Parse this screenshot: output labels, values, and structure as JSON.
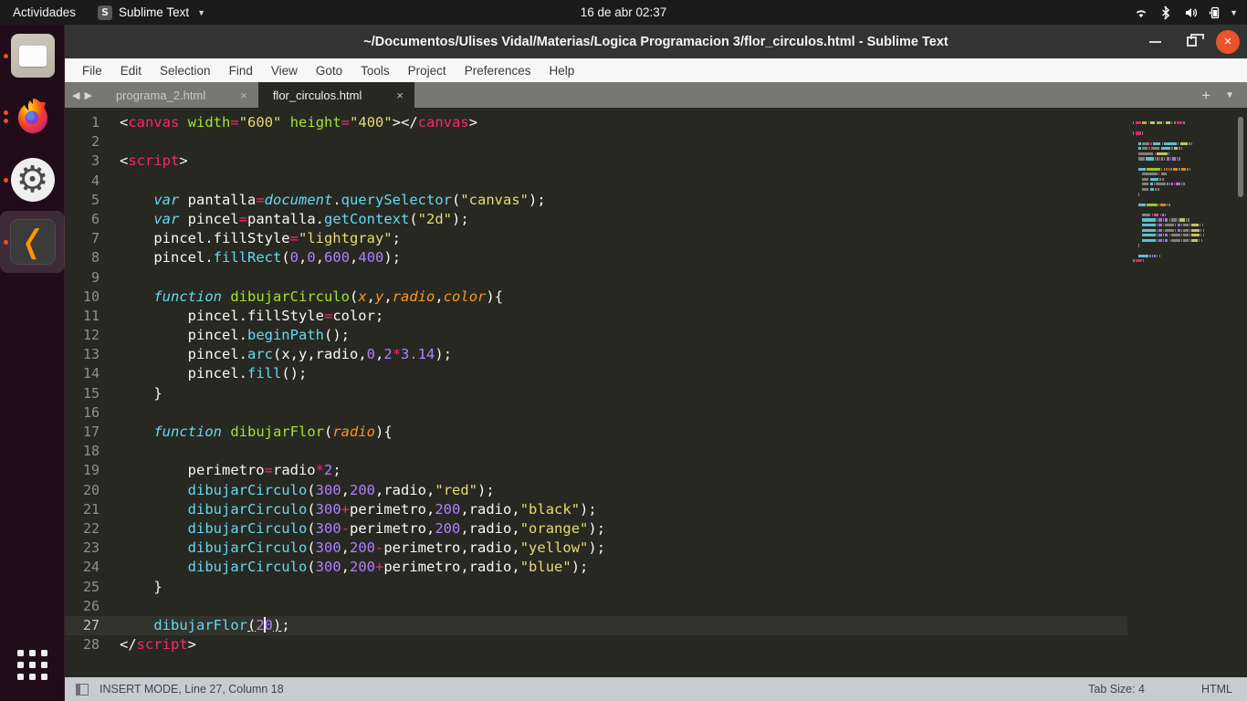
{
  "topbar": {
    "activities": "Actividades",
    "app_name": "Sublime Text",
    "app_icon": "sublime-icon",
    "app_icon_glyph": "S",
    "clock": "16 de abr  02:37",
    "tray_icons": [
      "wifi-icon",
      "bluetooth-icon",
      "volume-icon",
      "battery-icon",
      "chevron-down-icon"
    ]
  },
  "dock": {
    "items": [
      {
        "name": "files",
        "label": "Files",
        "running": true
      },
      {
        "name": "firefox",
        "label": "Firefox",
        "running": true
      },
      {
        "name": "settings",
        "label": "Settings",
        "running": true
      },
      {
        "name": "sublime-text",
        "label": "Sublime Text",
        "running": true,
        "active": true
      }
    ],
    "app_grid_label": "Show Applications"
  },
  "window": {
    "title": "~/Documentos/Ulises Vidal/Materias/Logica Programacion 3/flor_circulos.html - Sublime Text",
    "controls": {
      "minimize": "minimize-button",
      "maximize": "maximize-button",
      "close": "close-button",
      "close_glyph": "×"
    }
  },
  "menubar": {
    "items": [
      "File",
      "Edit",
      "Selection",
      "Find",
      "View",
      "Goto",
      "Tools",
      "Project",
      "Preferences",
      "Help"
    ]
  },
  "tabbar": {
    "nav_prev": "◀",
    "nav_next": "▶",
    "close_glyph": "×",
    "new_tab_glyph": "+",
    "tab_list_glyph": "▼",
    "tabs": [
      {
        "label": "programa_2.html",
        "active": false
      },
      {
        "label": "flor_circulos.html",
        "active": true
      }
    ]
  },
  "editor": {
    "cursor_line": 27,
    "total_lines": 28,
    "lines": [
      {
        "n": 1,
        "tokens": [
          [
            "punc",
            "<"
          ],
          [
            "tag",
            "canvas"
          ],
          [
            "plain",
            " "
          ],
          [
            "attr",
            "width"
          ],
          [
            "op",
            "="
          ],
          [
            "str",
            "\"600\""
          ],
          [
            "plain",
            " "
          ],
          [
            "attr",
            "height"
          ],
          [
            "op",
            "="
          ],
          [
            "str",
            "\"400\""
          ],
          [
            "punc",
            ">"
          ],
          [
            "punc",
            "</"
          ],
          [
            "tag",
            "canvas"
          ],
          [
            "punc",
            ">"
          ]
        ]
      },
      {
        "n": 2,
        "tokens": []
      },
      {
        "n": 3,
        "tokens": [
          [
            "punc",
            "<"
          ],
          [
            "tag",
            "script"
          ],
          [
            "punc",
            ">"
          ]
        ]
      },
      {
        "n": 4,
        "tokens": []
      },
      {
        "n": 5,
        "tokens": [
          [
            "plain",
            "    "
          ],
          [
            "kw",
            "var"
          ],
          [
            "plain",
            " pantalla"
          ],
          [
            "op",
            "="
          ],
          [
            "kw",
            "document"
          ],
          [
            "plain",
            "."
          ],
          [
            "meth",
            "querySelector"
          ],
          [
            "punc",
            "("
          ],
          [
            "str",
            "\"canvas\""
          ],
          [
            "punc",
            ")"
          ],
          [
            "plain",
            ";"
          ]
        ]
      },
      {
        "n": 6,
        "tokens": [
          [
            "plain",
            "    "
          ],
          [
            "kw",
            "var"
          ],
          [
            "plain",
            " pincel"
          ],
          [
            "op",
            "="
          ],
          [
            "plain",
            "pantalla."
          ],
          [
            "meth",
            "getContext"
          ],
          [
            "punc",
            "("
          ],
          [
            "str",
            "\"2d\""
          ],
          [
            "punc",
            ")"
          ],
          [
            "plain",
            ";"
          ]
        ]
      },
      {
        "n": 7,
        "tokens": [
          [
            "plain",
            "    pincel.fillStyle"
          ],
          [
            "op",
            "="
          ],
          [
            "str",
            "\"lightgray\""
          ],
          [
            "plain",
            ";"
          ]
        ]
      },
      {
        "n": 8,
        "tokens": [
          [
            "plain",
            "    pincel."
          ],
          [
            "meth",
            "fillRect"
          ],
          [
            "punc",
            "("
          ],
          [
            "num",
            "0"
          ],
          [
            "punc",
            ","
          ],
          [
            "num",
            "0"
          ],
          [
            "punc",
            ","
          ],
          [
            "num",
            "600"
          ],
          [
            "punc",
            ","
          ],
          [
            "num",
            "400"
          ],
          [
            "punc",
            ")"
          ],
          [
            "plain",
            ";"
          ]
        ]
      },
      {
        "n": 9,
        "tokens": []
      },
      {
        "n": 10,
        "tokens": [
          [
            "plain",
            "    "
          ],
          [
            "kw",
            "function"
          ],
          [
            "plain",
            " "
          ],
          [
            "fn",
            "dibujarCirculo"
          ],
          [
            "punc",
            "("
          ],
          [
            "param",
            "x"
          ],
          [
            "punc",
            ","
          ],
          [
            "param",
            "y"
          ],
          [
            "punc",
            ","
          ],
          [
            "param",
            "radio"
          ],
          [
            "punc",
            ","
          ],
          [
            "param",
            "color"
          ],
          [
            "punc",
            ")"
          ],
          [
            "plain",
            "{"
          ]
        ]
      },
      {
        "n": 11,
        "tokens": [
          [
            "plain",
            "        pincel.fillStyle"
          ],
          [
            "op",
            "="
          ],
          [
            "plain",
            "color;"
          ]
        ]
      },
      {
        "n": 12,
        "tokens": [
          [
            "plain",
            "        pincel."
          ],
          [
            "meth",
            "beginPath"
          ],
          [
            "punc",
            "()"
          ],
          [
            "plain",
            ";"
          ]
        ]
      },
      {
        "n": 13,
        "tokens": [
          [
            "plain",
            "        pincel."
          ],
          [
            "meth",
            "arc"
          ],
          [
            "punc",
            "("
          ],
          [
            "plain",
            "x,y,radio,"
          ],
          [
            "num",
            "0"
          ],
          [
            "punc",
            ","
          ],
          [
            "num",
            "2"
          ],
          [
            "op",
            "*"
          ],
          [
            "num",
            "3.14"
          ],
          [
            "punc",
            ")"
          ],
          [
            "plain",
            ";"
          ]
        ]
      },
      {
        "n": 14,
        "tokens": [
          [
            "plain",
            "        pincel."
          ],
          [
            "meth",
            "fill"
          ],
          [
            "punc",
            "()"
          ],
          [
            "plain",
            ";"
          ]
        ]
      },
      {
        "n": 15,
        "tokens": [
          [
            "plain",
            "    }"
          ]
        ]
      },
      {
        "n": 16,
        "tokens": []
      },
      {
        "n": 17,
        "tokens": [
          [
            "plain",
            "    "
          ],
          [
            "kw",
            "function"
          ],
          [
            "plain",
            " "
          ],
          [
            "fn",
            "dibujarFlor"
          ],
          [
            "punc",
            "("
          ],
          [
            "param",
            "radio"
          ],
          [
            "punc",
            ")"
          ],
          [
            "plain",
            "{"
          ]
        ]
      },
      {
        "n": 18,
        "tokens": []
      },
      {
        "n": 19,
        "tokens": [
          [
            "plain",
            "        perimetro"
          ],
          [
            "op",
            "="
          ],
          [
            "plain",
            "radio"
          ],
          [
            "op",
            "*"
          ],
          [
            "num",
            "2"
          ],
          [
            "plain",
            ";"
          ]
        ]
      },
      {
        "n": 20,
        "tokens": [
          [
            "plain",
            "        "
          ],
          [
            "meth",
            "dibujarCirculo"
          ],
          [
            "punc",
            "("
          ],
          [
            "num",
            "300"
          ],
          [
            "punc",
            ","
          ],
          [
            "num",
            "200"
          ],
          [
            "punc",
            ","
          ],
          [
            "plain",
            "radio"
          ],
          [
            "punc",
            ","
          ],
          [
            "str",
            "\"red\""
          ],
          [
            "punc",
            ")"
          ],
          [
            "plain",
            ";"
          ]
        ]
      },
      {
        "n": 21,
        "tokens": [
          [
            "plain",
            "        "
          ],
          [
            "meth",
            "dibujarCirculo"
          ],
          [
            "punc",
            "("
          ],
          [
            "num",
            "300"
          ],
          [
            "op",
            "+"
          ],
          [
            "plain",
            "perimetro"
          ],
          [
            "punc",
            ","
          ],
          [
            "num",
            "200"
          ],
          [
            "punc",
            ","
          ],
          [
            "plain",
            "radio"
          ],
          [
            "punc",
            ","
          ],
          [
            "str",
            "\"black\""
          ],
          [
            "punc",
            ")"
          ],
          [
            "plain",
            ";"
          ]
        ]
      },
      {
        "n": 22,
        "tokens": [
          [
            "plain",
            "        "
          ],
          [
            "meth",
            "dibujarCirculo"
          ],
          [
            "punc",
            "("
          ],
          [
            "num",
            "300"
          ],
          [
            "op",
            "-"
          ],
          [
            "plain",
            "perimetro"
          ],
          [
            "punc",
            ","
          ],
          [
            "num",
            "200"
          ],
          [
            "punc",
            ","
          ],
          [
            "plain",
            "radio"
          ],
          [
            "punc",
            ","
          ],
          [
            "str",
            "\"orange\""
          ],
          [
            "punc",
            ")"
          ],
          [
            "plain",
            ";"
          ]
        ]
      },
      {
        "n": 23,
        "tokens": [
          [
            "plain",
            "        "
          ],
          [
            "meth",
            "dibujarCirculo"
          ],
          [
            "punc",
            "("
          ],
          [
            "num",
            "300"
          ],
          [
            "punc",
            ","
          ],
          [
            "num",
            "200"
          ],
          [
            "op",
            "-"
          ],
          [
            "plain",
            "perimetro"
          ],
          [
            "punc",
            ","
          ],
          [
            "plain",
            "radio"
          ],
          [
            "punc",
            ","
          ],
          [
            "str",
            "\"yellow\""
          ],
          [
            "punc",
            ")"
          ],
          [
            "plain",
            ";"
          ]
        ]
      },
      {
        "n": 24,
        "tokens": [
          [
            "plain",
            "        "
          ],
          [
            "meth",
            "dibujarCirculo"
          ],
          [
            "punc",
            "("
          ],
          [
            "num",
            "300"
          ],
          [
            "punc",
            ","
          ],
          [
            "num",
            "200"
          ],
          [
            "op",
            "+"
          ],
          [
            "plain",
            "perimetro"
          ],
          [
            "punc",
            ","
          ],
          [
            "plain",
            "radio"
          ],
          [
            "punc",
            ","
          ],
          [
            "str",
            "\"blue\""
          ],
          [
            "punc",
            ")"
          ],
          [
            "plain",
            ";"
          ]
        ]
      },
      {
        "n": 25,
        "tokens": [
          [
            "plain",
            "    }"
          ]
        ]
      },
      {
        "n": 26,
        "tokens": []
      },
      {
        "n": 27,
        "tokens": [
          [
            "plain",
            "    "
          ],
          [
            "meth",
            "dibujarFlor"
          ],
          [
            "match",
            "("
          ],
          [
            "num",
            "2"
          ],
          [
            "caret",
            ""
          ],
          [
            "num",
            "0"
          ],
          [
            "match",
            ")"
          ],
          [
            "plain",
            ";"
          ]
        ]
      },
      {
        "n": 28,
        "tokens": [
          [
            "punc",
            "</"
          ],
          [
            "tag",
            "script"
          ],
          [
            "punc",
            ">"
          ]
        ]
      }
    ]
  },
  "statusbar": {
    "sidebar_toggle": "sidebar-toggle-icon",
    "message": "INSERT MODE, Line 27, Column 18",
    "tab_size": "Tab Size: 4",
    "syntax": "HTML"
  },
  "colors": {
    "editor_bg": "#272822",
    "accent_orange": "#e95420",
    "tag_pink": "#f92672",
    "string_yellow": "#e6db74",
    "keyword_cyan": "#66d9ef",
    "function_green": "#a6e22e",
    "number_purple": "#ae81ff",
    "param_orange": "#fd971f"
  }
}
